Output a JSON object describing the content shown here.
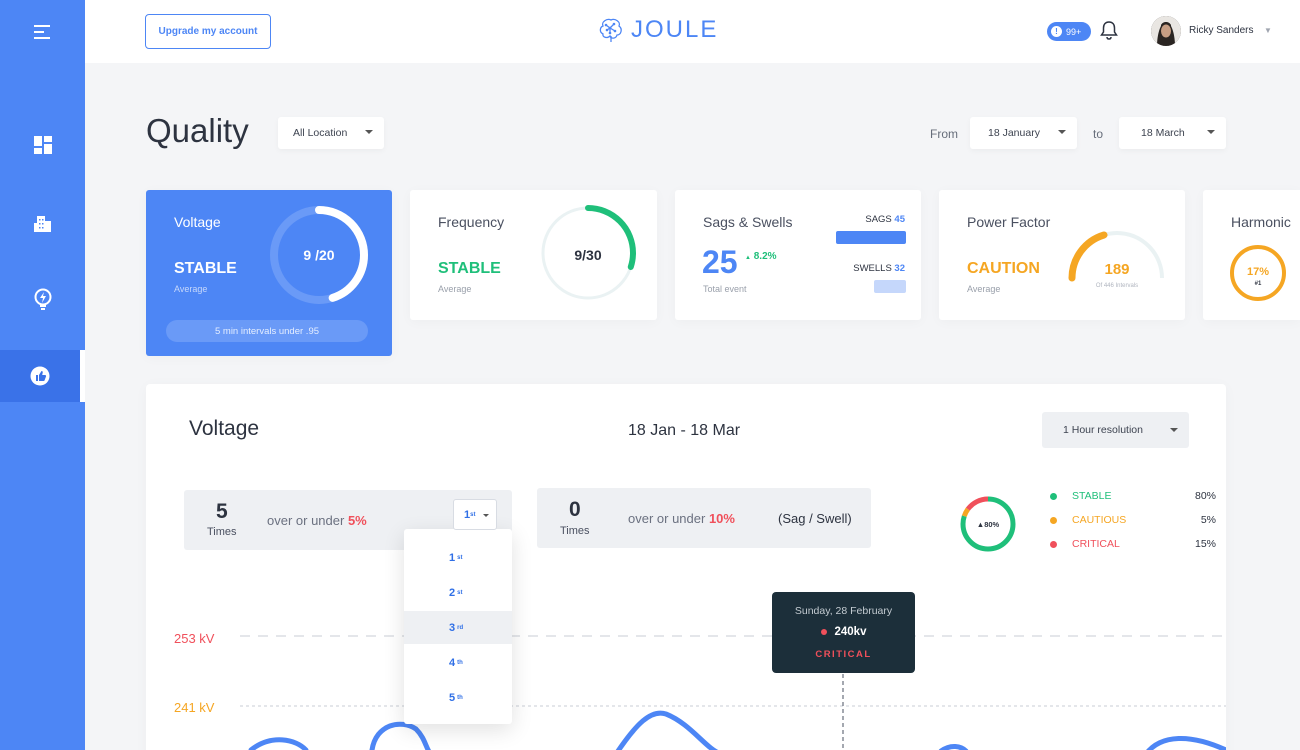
{
  "header": {
    "upgrade_label": "Upgrade my account",
    "logo_text": "JOULE",
    "notifications_count": "99+",
    "user_name": "Ricky Sanders"
  },
  "page": {
    "title": "Quality",
    "location_filter": "All Location",
    "from_label": "From",
    "from_value": "18 January",
    "to_label": "to",
    "to_value": "18 March"
  },
  "cards": {
    "voltage": {
      "title": "Voltage",
      "status": "STABLE",
      "sub": "Average",
      "gauge_text": "9 /20",
      "gauge_fraction": 0.45,
      "footer": "5 min intervals under .95"
    },
    "frequency": {
      "title": "Frequency",
      "status": "STABLE",
      "sub": "Average",
      "gauge_text": "9/30",
      "gauge_fraction": 0.3
    },
    "sags": {
      "title": "Sags & Swells",
      "total": "25",
      "delta": "8.2%",
      "sub": "Total event",
      "sags_label": "SAGS",
      "sags_value": "45",
      "swells_label": "SWELLS",
      "swells_value": "32"
    },
    "power_factor": {
      "title": "Power Factor",
      "status": "CAUTION",
      "sub": "Average",
      "gauge_value": "189",
      "gauge_sub": "Of 446 Intervals"
    },
    "harmonic": {
      "title": "Harmonic",
      "gauge_value": "17%",
      "gauge_sub": "#1"
    }
  },
  "panel": {
    "title": "Voltage",
    "range": "18 Jan - 18 Mar",
    "resolution": "1 Hour resolution",
    "stat1": {
      "num": "5",
      "times": "Times",
      "desc_prefix": "over or under",
      "desc_pct": "5%",
      "rank": "1",
      "rank_suffix": "st"
    },
    "stat2": {
      "num": "0",
      "times": "Times",
      "desc_prefix": "over or under",
      "desc_pct": "10%",
      "extra": "(Sag / Swell)"
    },
    "donut_label": "80%",
    "legend": [
      {
        "label": "STABLE",
        "pct": "80%",
        "color": "#1fbf7a"
      },
      {
        "label": "CAUTIOUS",
        "pct": "5%",
        "color": "#f5a623"
      },
      {
        "label": "CRITICAL",
        "pct": "15%",
        "color": "#f0505b"
      }
    ],
    "rank_options": [
      {
        "num": "1",
        "suffix": "st"
      },
      {
        "num": "2",
        "suffix": "st"
      },
      {
        "num": "3",
        "suffix": "rd"
      },
      {
        "num": "4",
        "suffix": "th"
      },
      {
        "num": "5",
        "suffix": "th"
      }
    ],
    "ref_high": "253 kV",
    "ref_low": "241 kV",
    "tooltip": {
      "date": "Sunday, 28 February",
      "value": "240kv",
      "status": "CRITICAL"
    }
  },
  "colors": {
    "primary": "#4d86f5",
    "stable": "#1fbf7a",
    "caution": "#f5a623",
    "critical": "#f0505b"
  },
  "icons": [
    "menu-icon",
    "dashboard-icon",
    "buildings-icon",
    "lightning-bulb-icon",
    "thumbs-up-icon",
    "brain-logo-icon",
    "bell-icon"
  ]
}
